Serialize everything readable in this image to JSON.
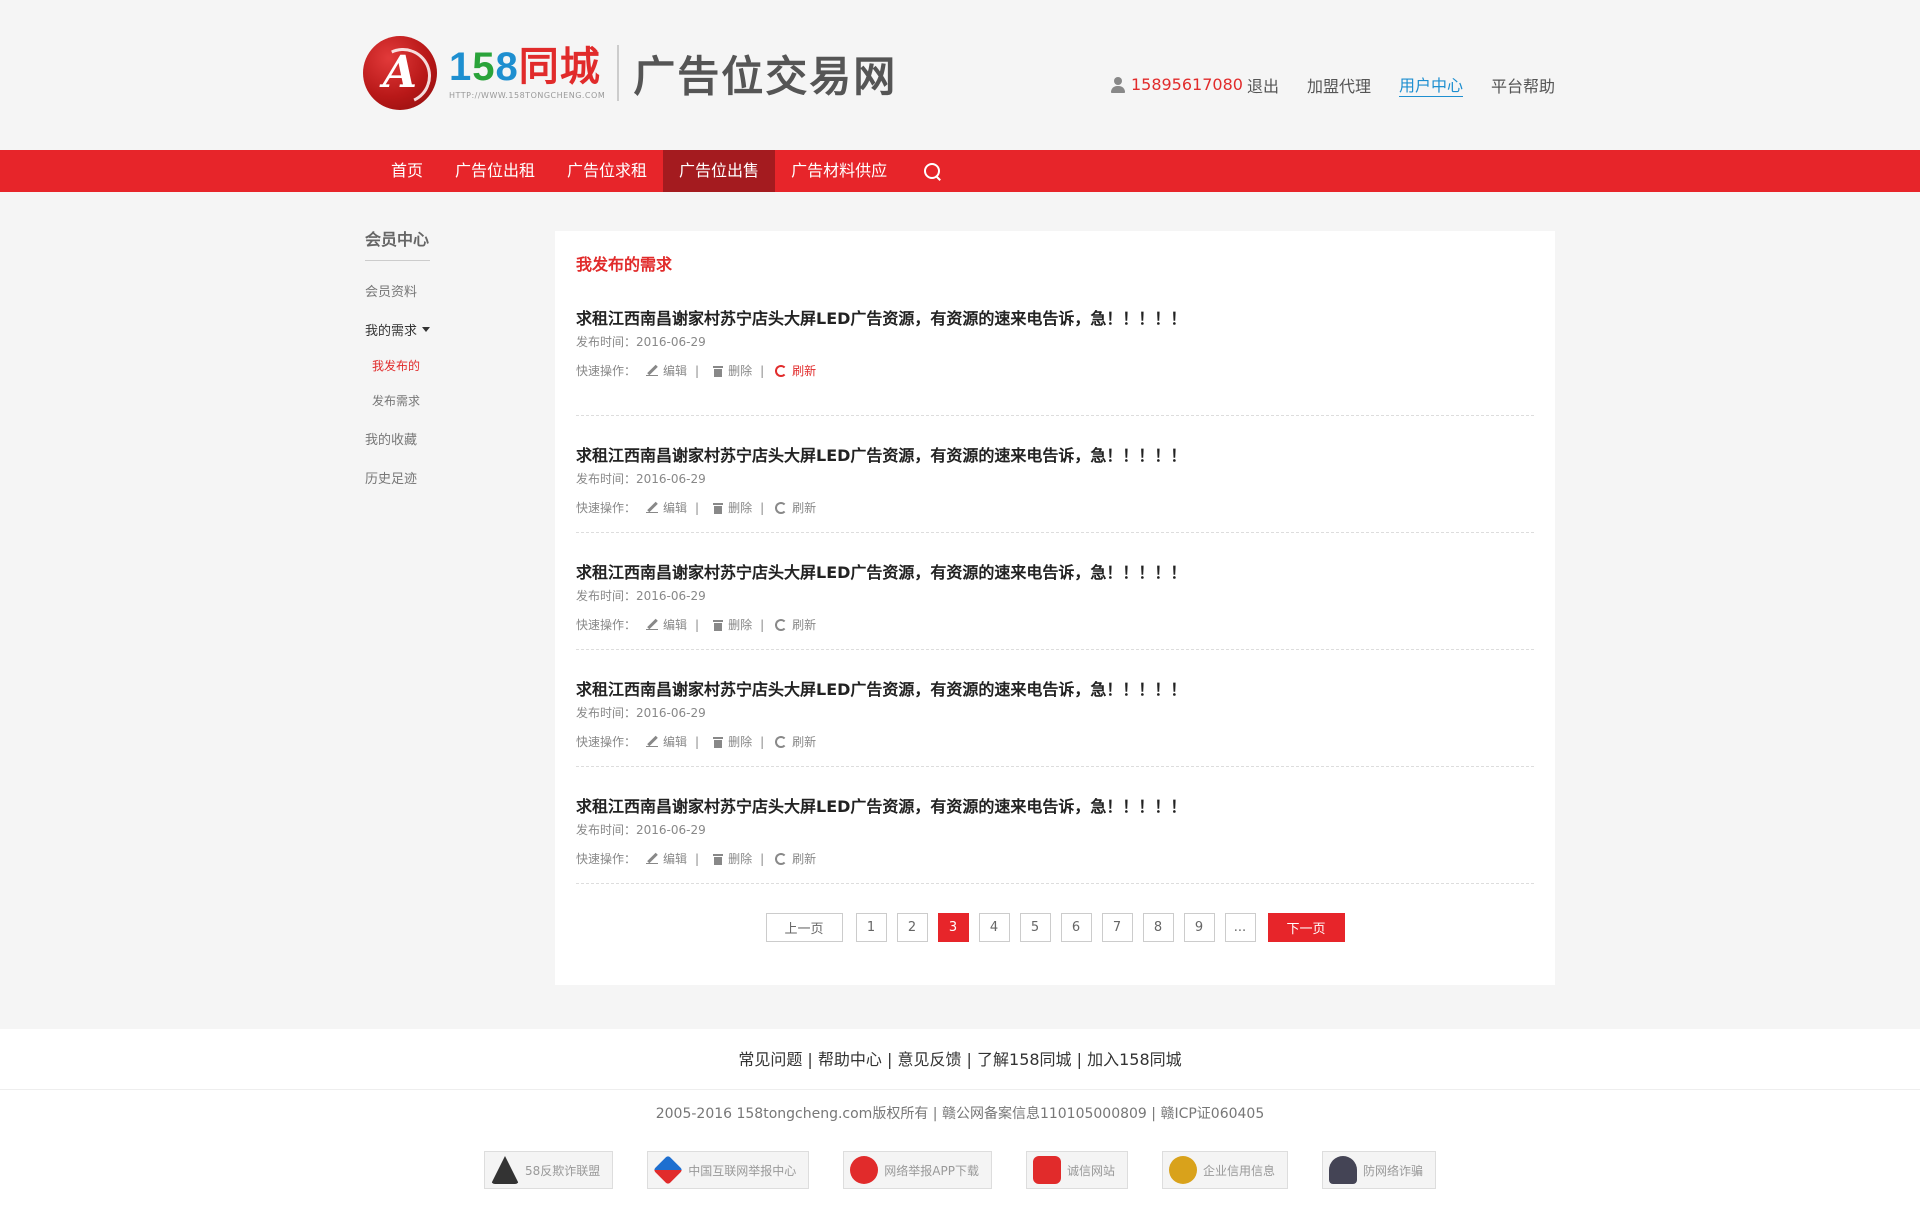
{
  "header": {
    "logo_mark": "A",
    "brand_1": "1",
    "brand_5": "5",
    "brand_8": "8",
    "brand_cn": "同城",
    "brand_url": "HTTP://WWW.158TONGCHENG.COM",
    "site_title": "广告位交易网",
    "user_phone": "15895617080",
    "logout": "退出",
    "links": [
      "加盟代理",
      "用户中心",
      "平台帮助"
    ],
    "active_link": "用户中心"
  },
  "nav": {
    "items": [
      "首页",
      "广告位出租",
      "广告位求租",
      "广告位出售",
      "广告材料供应"
    ],
    "active": "广告位出售"
  },
  "sidebar": {
    "title": "会员中心",
    "member_info": "会员资料",
    "my_needs": "我的需求",
    "sub_published": "我发布的",
    "sub_post": "发布需求",
    "favorites": "我的收藏",
    "history": "历史足迹"
  },
  "main": {
    "heading": "我发布的需求",
    "ops_label": "快速操作：",
    "edit": "编辑",
    "delete": "删除",
    "refresh": "刷新",
    "pipe": "|",
    "items": [
      {
        "title": "求租江西南昌谢家村苏宁店头大屏LED广告资源，有资源的速来电告诉，急！！！！！",
        "date": "发布时间：2016-06-29"
      },
      {
        "title": "求租江西南昌谢家村苏宁店头大屏LED广告资源，有资源的速来电告诉，急！！！！！",
        "date": "发布时间：2016-06-29"
      },
      {
        "title": "求租江西南昌谢家村苏宁店头大屏LED广告资源，有资源的速来电告诉，急！！！！！",
        "date": "发布时间：2016-06-29"
      },
      {
        "title": "求租江西南昌谢家村苏宁店头大屏LED广告资源，有资源的速来电告诉，急！！！！！",
        "date": "发布时间：2016-06-29"
      },
      {
        "title": "求租江西南昌谢家村苏宁店头大屏LED广告资源，有资源的速来电告诉，急！！！！！",
        "date": "发布时间：2016-06-29"
      }
    ]
  },
  "pager": {
    "prev": "上一页",
    "pages": [
      "1",
      "2",
      "3",
      "4",
      "5",
      "6",
      "7",
      "8",
      "9",
      "..."
    ],
    "current": "3",
    "next": "下一页"
  },
  "footer": {
    "links": "常见问题 | 帮助中心 | 意见反馈 | 了解158同城 | 加入158同城",
    "copyright": "2005-2016 158tongcheng.com版权所有 | 赣公网备案信息110105000809 | 赣ICP证060405",
    "badges": [
      {
        "label": "58反欺诈联盟",
        "icon": "anti-fraud-icon",
        "cls": "anti"
      },
      {
        "label": "中国互联网举报中心",
        "icon": "report-center-icon",
        "cls": "cnreport"
      },
      {
        "label": "网络举报APP下载",
        "icon": "app-download-icon",
        "cls": "app"
      },
      {
        "label": "诚信网站",
        "icon": "credit-site-icon",
        "cls": "credit"
      },
      {
        "label": "企业信用信息",
        "icon": "business-credit-icon",
        "cls": "biz"
      },
      {
        "label": "防网络诈骗",
        "icon": "police-icon",
        "cls": "police"
      }
    ]
  }
}
